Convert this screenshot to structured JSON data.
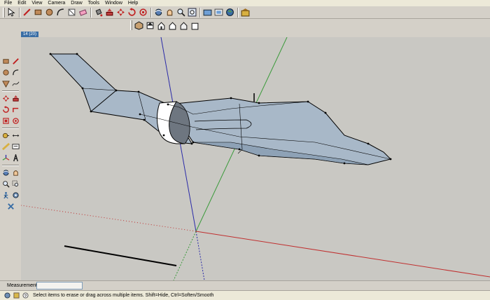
{
  "menu": [
    "File",
    "Edit",
    "View",
    "Camera",
    "Draw",
    "Tools",
    "Window",
    "Help"
  ],
  "toolbar_main": [
    {
      "name": "select-tool",
      "icon": "select-arrow-icon"
    },
    {
      "name": "line-tool",
      "icon": "pencil-icon"
    },
    {
      "name": "rectangle-tool",
      "icon": "rectangle-icon"
    },
    {
      "name": "circle-tool",
      "icon": "circle-icon"
    },
    {
      "name": "arc-tool",
      "icon": "arc-icon"
    },
    {
      "name": "make-component-tool",
      "icon": "component-icon"
    },
    {
      "name": "eraser-tool",
      "icon": "eraser-icon"
    },
    {
      "name": "paint-bucket-tool",
      "icon": "paint-bucket-icon"
    },
    {
      "name": "push-pull-tool",
      "icon": "push-pull-icon"
    },
    {
      "name": "move-tool",
      "icon": "move-icon"
    },
    {
      "name": "rotate-tool",
      "icon": "rotate-icon"
    },
    {
      "name": "offset-tool",
      "icon": "offset-icon"
    },
    {
      "name": "orbit-tool",
      "icon": "orbit-icon"
    },
    {
      "name": "pan-tool",
      "icon": "pan-hand-icon"
    },
    {
      "name": "zoom-tool",
      "icon": "zoom-icon"
    },
    {
      "name": "zoom-extents-tool",
      "icon": "zoom-extents-icon"
    },
    {
      "name": "get-models-button",
      "icon": "get-models-icon"
    },
    {
      "name": "share-model-button",
      "icon": "share-model-icon"
    },
    {
      "name": "google-earth-button",
      "icon": "google-earth-icon"
    },
    {
      "name": "component-warehouse-button",
      "icon": "warehouse-icon"
    }
  ],
  "toolbar_views": [
    {
      "name": "iso-view-button",
      "icon": "iso-view-icon"
    },
    {
      "name": "top-view-button",
      "icon": "top-view-icon"
    },
    {
      "name": "front-view-button",
      "icon": "front-view-icon"
    },
    {
      "name": "right-view-button",
      "icon": "right-view-icon"
    },
    {
      "name": "back-view-button",
      "icon": "back-view-icon"
    },
    {
      "name": "left-view-button",
      "icon": "left-view-icon"
    }
  ],
  "scene_tab": "14 (20)",
  "left_tools": [
    [
      "rectangle-icon",
      "pencil-icon"
    ],
    [
      "circle-icon",
      "arc-icon"
    ],
    [
      "polygon-icon",
      "freehand-icon"
    ],
    "sep",
    [
      "move-icon",
      "push-pull-icon"
    ],
    [
      "rotate-icon",
      "follow-me-icon"
    ],
    [
      "scale-icon",
      "offset-icon"
    ],
    "sep",
    [
      "tape-measure-icon",
      "dimension-icon"
    ],
    [
      "protractor-icon",
      "text-icon"
    ],
    [
      "axes-icon",
      "3d-text-icon"
    ],
    "sep",
    [
      "orbit-icon",
      "pan-hand-icon"
    ],
    [
      "zoom-icon",
      "zoom-window-icon"
    ],
    [
      "walk-icon",
      "look-around-icon"
    ],
    [
      "position-camera-icon"
    ]
  ],
  "measurements": {
    "label": "Measurements",
    "value": ""
  },
  "status": {
    "text": "Select items to erase or drag across multiple items. Shift=Hide, Ctrl=Soften/Smooth"
  },
  "colors": {
    "accent": "#3a6ea5",
    "face": "#a8b8c8",
    "axis_red": "#c03030",
    "axis_green": "#3a9a3a",
    "axis_blue": "#2a2aa8",
    "viewport_bg": "#c9c8c3"
  }
}
